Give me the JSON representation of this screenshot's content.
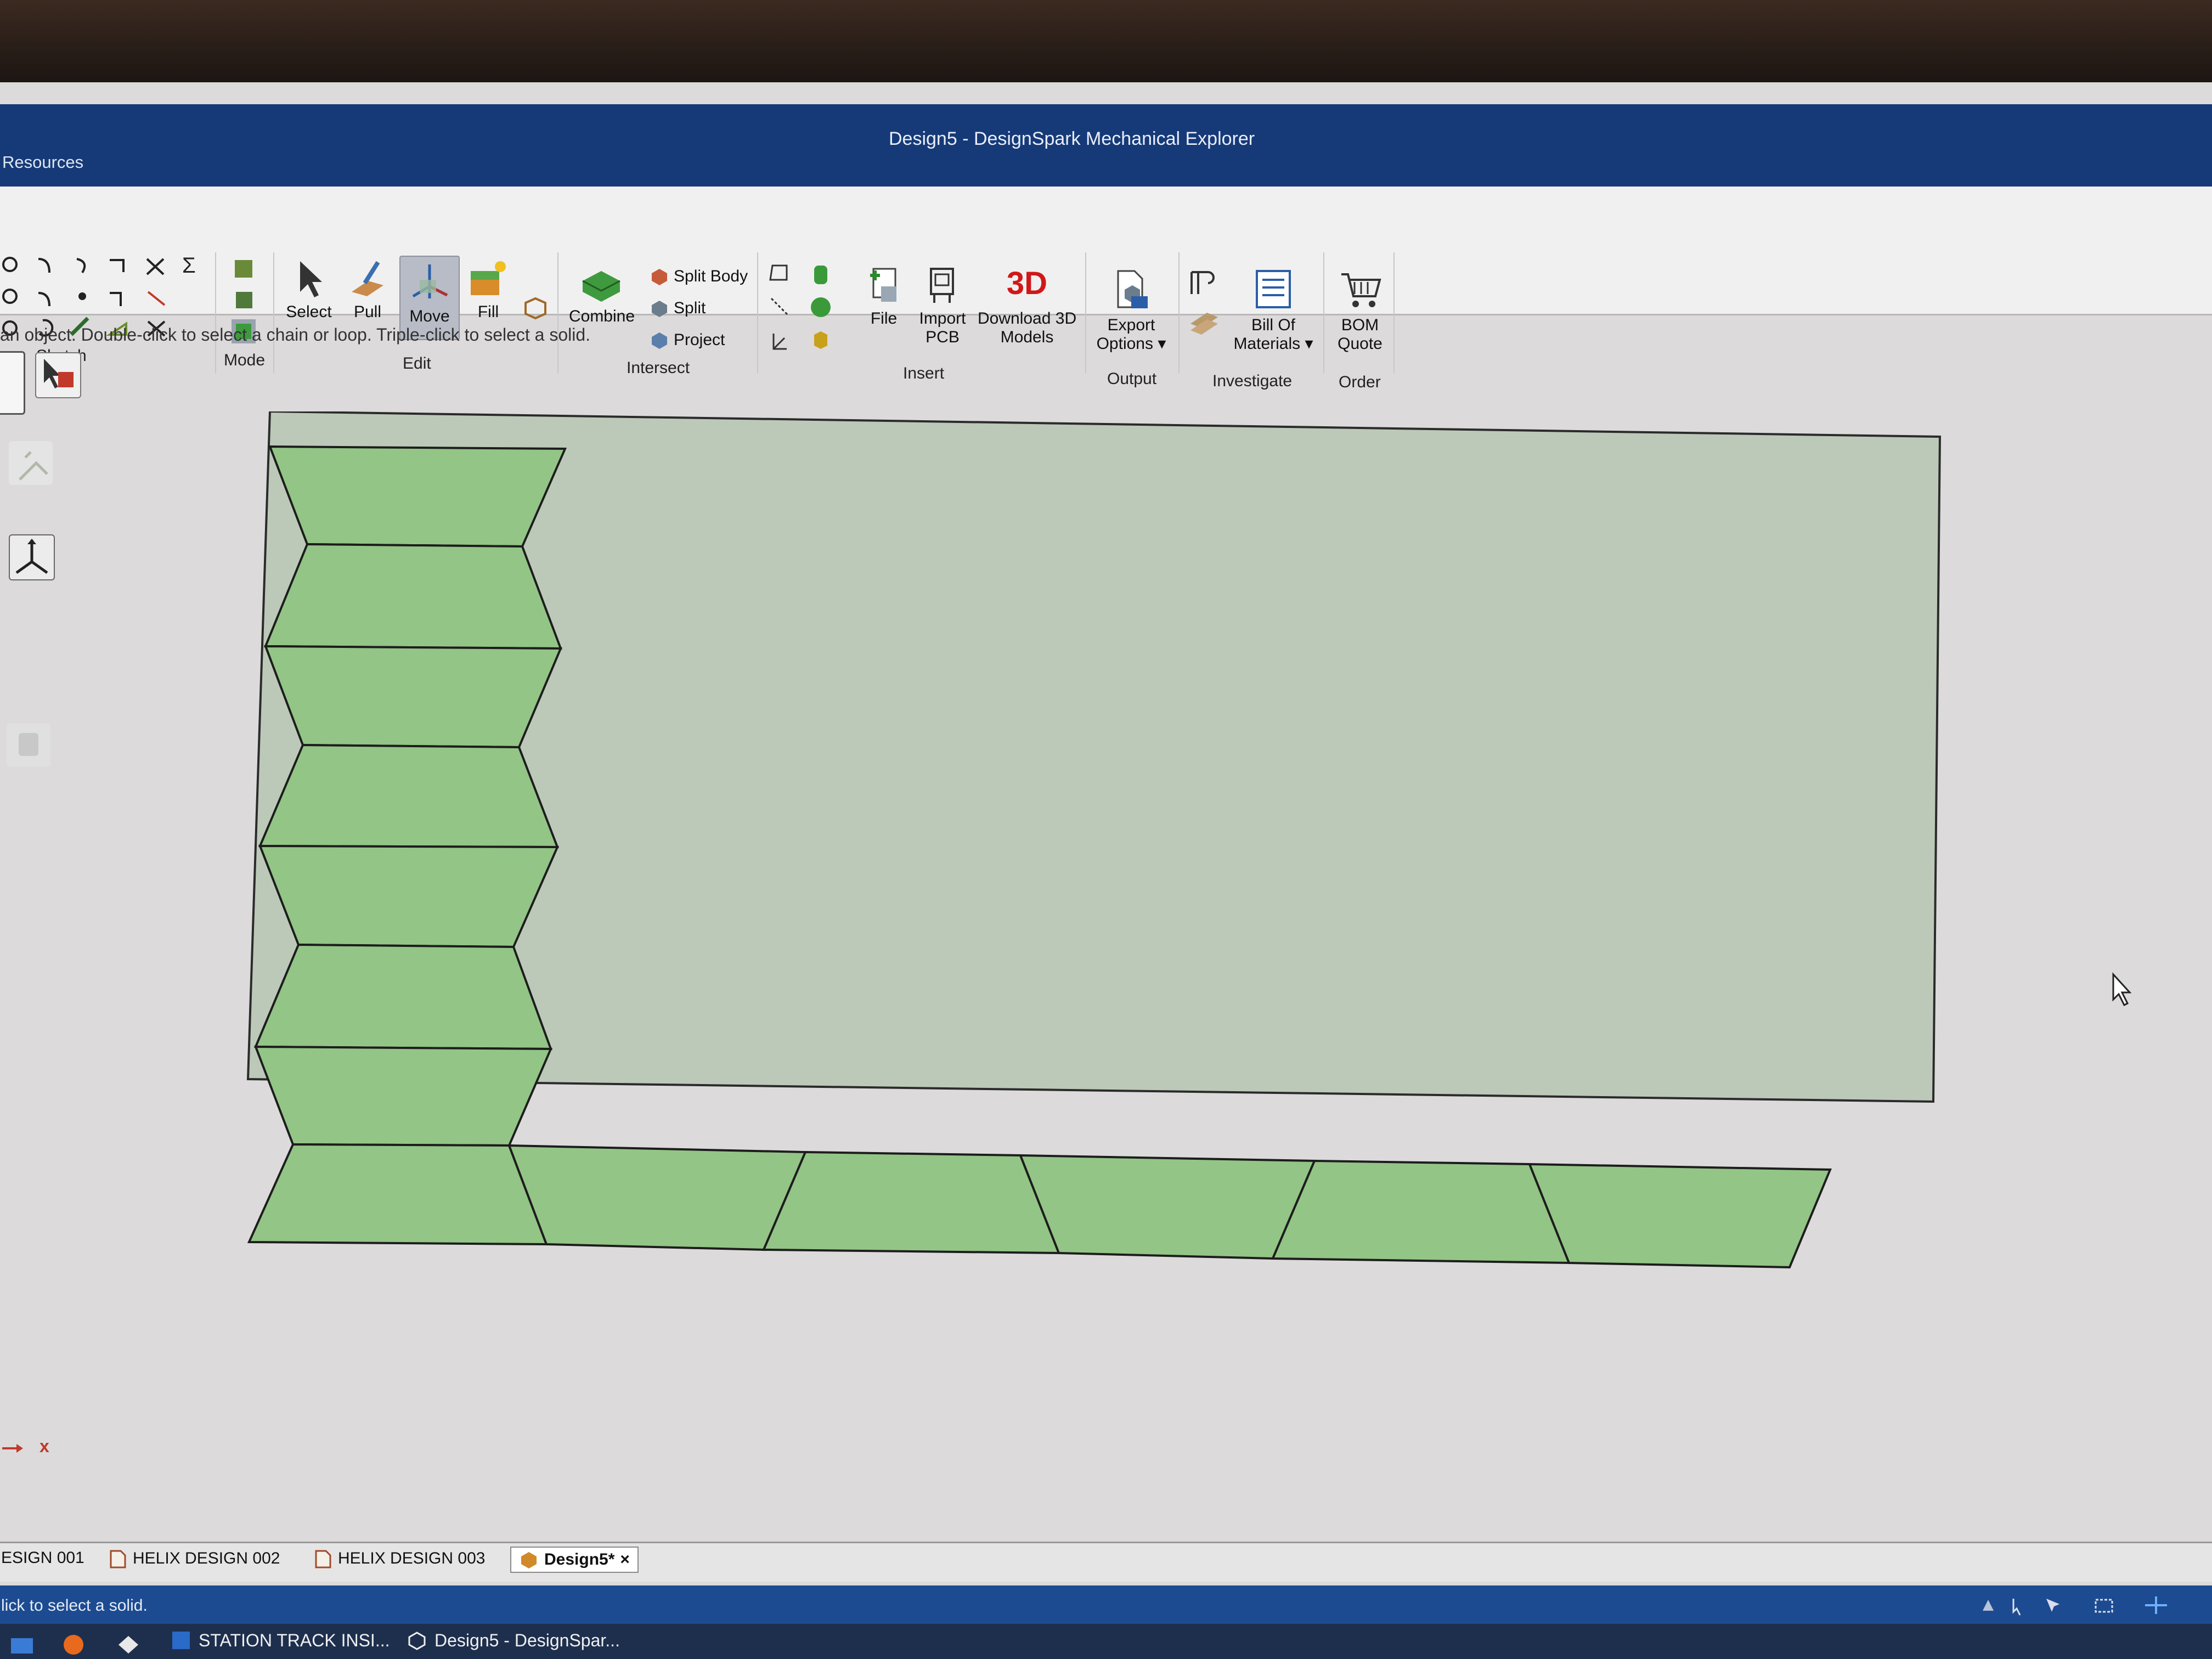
{
  "window": {
    "title": "Design5 - DesignSpark Mechanical Explorer",
    "left_menu": "Resources"
  },
  "ribbon": {
    "groups": {
      "sketch": "Sketch",
      "mode": "Mode",
      "edit": "Edit",
      "intersect": "Intersect",
      "insert": "Insert",
      "output": "Output",
      "investigate": "Investigate",
      "order": "Order"
    },
    "buttons": {
      "select": "Select",
      "pull": "Pull",
      "move": "Move",
      "fill": "Fill",
      "combine": "Combine",
      "split_body": "Split Body",
      "split": "Split",
      "project": "Project",
      "file": "File",
      "import_pcb_1": "Import",
      "import_pcb_2": "PCB",
      "download_3d_1": "Download 3D",
      "download_3d_2": "Models",
      "export_1": "Export",
      "export_2": "Options",
      "bom_1": "Bill Of",
      "bom_2": "Materials",
      "bom_quote_1": "BOM",
      "bom_quote_2": "Quote"
    },
    "download_logo": "3D",
    "sigma": "Σ"
  },
  "hint": "an object.  Double-click to select a chain or loop.  Triple-click to select a solid.",
  "axis": {
    "label": "x"
  },
  "doc_tabs": [
    "ESIGN 001",
    "HELIX DESIGN 002",
    "HELIX DESIGN 003",
    "Design5*"
  ],
  "doc_tab_close": "×",
  "status": {
    "text": "lick to select a solid."
  },
  "taskbar": {
    "items": [
      "STATION TRACK INSI...",
      "Design5 - DesignSpar..."
    ]
  },
  "colors": {
    "title_bar": "#163a78",
    "canvas_bg": "#bcc9b8",
    "panel_fill": "#93c586",
    "status_bar": "#1c4b91"
  }
}
